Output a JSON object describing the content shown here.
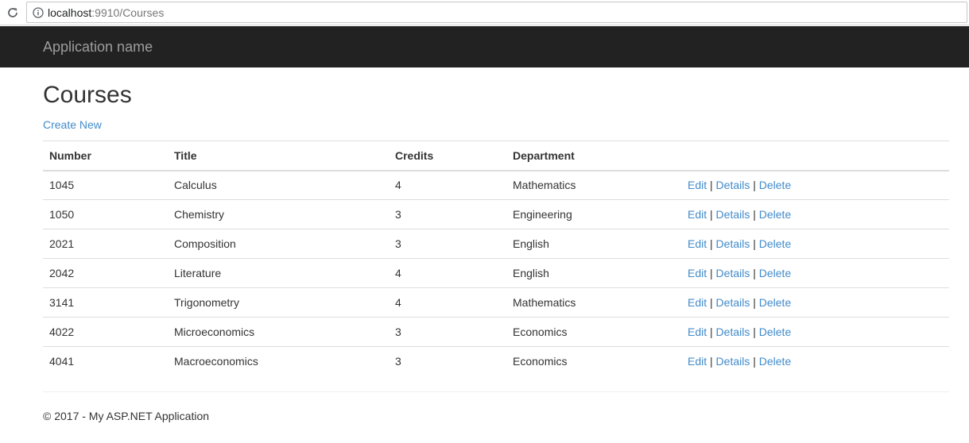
{
  "browser": {
    "url_host": "localhost",
    "url_rest": ":9910/Courses",
    "reload_icon": "reload-icon",
    "info_icon": "info-icon"
  },
  "navbar": {
    "brand": "Application name",
    "background": "#222222"
  },
  "page": {
    "title": "Courses",
    "create_new": "Create New"
  },
  "table": {
    "headers": {
      "number": "Number",
      "title": "Title",
      "credits": "Credits",
      "department": "Department"
    },
    "rows": [
      {
        "number": "1045",
        "title": "Calculus",
        "credits": "4",
        "department": "Mathematics"
      },
      {
        "number": "1050",
        "title": "Chemistry",
        "credits": "3",
        "department": "Engineering"
      },
      {
        "number": "2021",
        "title": "Composition",
        "credits": "3",
        "department": "English"
      },
      {
        "number": "2042",
        "title": "Literature",
        "credits": "4",
        "department": "English"
      },
      {
        "number": "3141",
        "title": "Trigonometry",
        "credits": "4",
        "department": "Mathematics"
      },
      {
        "number": "4022",
        "title": "Microeconomics",
        "credits": "3",
        "department": "Economics"
      },
      {
        "number": "4041",
        "title": "Macroeconomics",
        "credits": "3",
        "department": "Economics"
      }
    ],
    "actions": {
      "edit": "Edit",
      "details": "Details",
      "delete": "Delete",
      "separator": "|"
    }
  },
  "footer": {
    "text": "© 2017 - My ASP.NET Application"
  },
  "colors": {
    "link": "#428bca",
    "brand_text": "#9d9d9d"
  }
}
